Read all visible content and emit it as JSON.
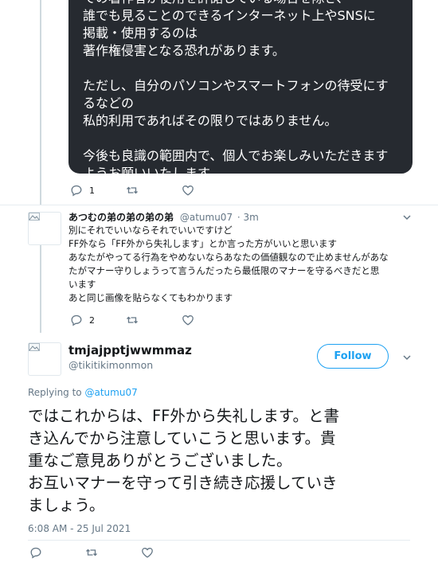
{
  "quoted_card": {
    "paragraphs": [
      [
        "での著作者が使用を許諾している場合を除き、",
        "誰でも見ることのできるインターネット上やSNSに",
        "掲載・使用するのは",
        "著作権侵害となる恐れがあります。"
      ],
      [
        "ただし、自分のパソコンやスマートフォンの待受にす",
        "るなどの",
        "私的利用であればその限りではありません。"
      ],
      [
        "今後も良識の範囲内で、個人でお楽しみいただきます",
        "ようお願いいたします。"
      ]
    ]
  },
  "tweet1": {
    "reply_count": "1",
    "icons": [
      "reply-icon",
      "retweet-icon",
      "like-icon"
    ]
  },
  "tweet2": {
    "name": "あつむの弟の弟の弟の弟",
    "handle": "@atumu07",
    "time": "· 3m",
    "lines": [
      "別にそれでいいならそれでいいですけど",
      "FF外なら「FF外から失礼します」とか言った方がいいと思います",
      "あなたがやってる行為をやめないならあなたの価値観なので止めませんがあな",
      "たがマナー守りしょうって言うんだったら最低限のマナーを守るべきだと思",
      "います",
      "あと同じ画像を貼らなくてもわかります"
    ],
    "reply_count": "2"
  },
  "main_tweet": {
    "name": "tmjajpptjwwmmaz",
    "handle": "@tikitikimonmon",
    "follow_label": "Follow",
    "replying_prefix": "Replying to",
    "replying_mention": "@atumu07",
    "lines": [
      "ではこれからは、FF外から失礼します。と書",
      "き込んでから注意していこうと思います。貴",
      "重なご意見ありがとうございました。",
      "お互いマナーを守って引き続き応援していき",
      "ましょう。"
    ],
    "timestamp": "6:08 AM - 25 Jul 2021"
  },
  "colors": {
    "accent": "#1da1f2",
    "dark_card": "#262a30",
    "muted": "#657786"
  }
}
